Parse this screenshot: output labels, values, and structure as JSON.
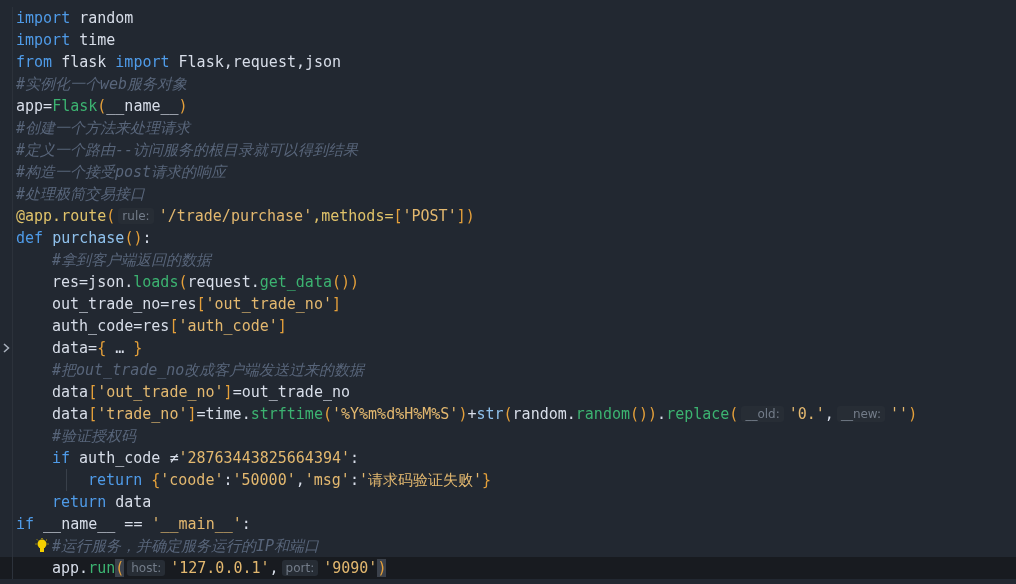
{
  "lines": [
    {
      "current": false,
      "tokens": [
        {
          "kind": "kw",
          "text": "import"
        },
        {
          "kind": "plain",
          "text": " random"
        }
      ]
    },
    {
      "current": false,
      "tokens": [
        {
          "kind": "kw",
          "text": "import"
        },
        {
          "kind": "plain",
          "text": " time"
        }
      ]
    },
    {
      "current": false,
      "tokens": [
        {
          "kind": "kw",
          "text": "from"
        },
        {
          "kind": "plain",
          "text": " flask "
        },
        {
          "kind": "kw",
          "text": "import"
        },
        {
          "kind": "plain",
          "text": " Flask,request,json"
        }
      ]
    },
    {
      "current": false,
      "tokens": [
        {
          "kind": "cm",
          "text": "#实例化一个web服务对象"
        }
      ]
    },
    {
      "current": false,
      "tokens": [
        {
          "kind": "plain",
          "text": "app="
        },
        {
          "kind": "fn",
          "text": "Flask"
        },
        {
          "kind": "br",
          "text": "("
        },
        {
          "kind": "plain",
          "text": "__name__"
        },
        {
          "kind": "br",
          "text": ")"
        }
      ]
    },
    {
      "current": false,
      "tokens": [
        {
          "kind": "cm",
          "text": "#创建一个方法来处理请求"
        }
      ]
    },
    {
      "current": false,
      "tokens": [
        {
          "kind": "cm",
          "text": "#定义一个路由--访问服务的根目录就可以得到结果"
        }
      ]
    },
    {
      "current": false,
      "tokens": [
        {
          "kind": "cm",
          "text": "#构造一个接受post请求的响应"
        }
      ]
    },
    {
      "current": false,
      "tokens": [
        {
          "kind": "cm",
          "text": "#处理极简交易接口"
        }
      ]
    },
    {
      "current": false,
      "tokens": [
        {
          "kind": "deco",
          "text": "@app.route"
        },
        {
          "kind": "br",
          "text": "("
        },
        {
          "kind": "hint",
          "text": "rule:"
        },
        {
          "kind": "str",
          "text": "'/trade/purchase'"
        },
        {
          "kind": "deco",
          "text": ",methods="
        },
        {
          "kind": "br",
          "text": "["
        },
        {
          "kind": "str",
          "text": "'POST'"
        },
        {
          "kind": "br",
          "text": "])"
        }
      ]
    },
    {
      "current": false,
      "tokens": [
        {
          "kind": "kw",
          "text": "def "
        },
        {
          "kind": "def",
          "text": "purchase"
        },
        {
          "kind": "br",
          "text": "()"
        },
        {
          "kind": "plain",
          "text": ":"
        }
      ],
      "children": [
        {
          "current": false,
          "tokens": [
            {
              "kind": "cm",
              "text": "#拿到客户端返回的数据"
            }
          ]
        },
        {
          "current": false,
          "tokens": [
            {
              "kind": "plain",
              "text": "res=json."
            },
            {
              "kind": "fn",
              "text": "loads"
            },
            {
              "kind": "br",
              "text": "("
            },
            {
              "kind": "plain",
              "text": "request."
            },
            {
              "kind": "fn",
              "text": "get_data"
            },
            {
              "kind": "br",
              "text": "())"
            }
          ]
        },
        {
          "current": false,
          "tokens": [
            {
              "kind": "plain",
              "text": "out_trade_no=res"
            },
            {
              "kind": "br",
              "text": "["
            },
            {
              "kind": "str",
              "text": "'out_trade_no'"
            },
            {
              "kind": "br",
              "text": "]"
            }
          ]
        },
        {
          "current": false,
          "tokens": [
            {
              "kind": "plain",
              "text": "auth_code=res"
            },
            {
              "kind": "br",
              "text": "["
            },
            {
              "kind": "str",
              "text": "'auth_code'"
            },
            {
              "kind": "br",
              "text": "]"
            }
          ]
        },
        {
          "current": false,
          "kind": "folded",
          "tokens": [
            {
              "kind": "plain",
              "text": "data="
            },
            {
              "kind": "br",
              "text": "{"
            },
            {
              "kind": "plain",
              "text": " … "
            },
            {
              "kind": "br",
              "text": "}"
            }
          ]
        },
        {
          "current": false,
          "tokens": [
            {
              "kind": "cm",
              "text": "#把out_trade_no改成客户端发送过来的数据"
            }
          ]
        },
        {
          "current": false,
          "tokens": [
            {
              "kind": "plain",
              "text": "data"
            },
            {
              "kind": "br",
              "text": "["
            },
            {
              "kind": "str",
              "text": "'out_trade_no'"
            },
            {
              "kind": "br",
              "text": "]"
            },
            {
              "kind": "plain",
              "text": "=out_trade_no"
            }
          ]
        },
        {
          "current": false,
          "tokens": [
            {
              "kind": "plain",
              "text": "data"
            },
            {
              "kind": "br",
              "text": "["
            },
            {
              "kind": "str",
              "text": "'trade_no'"
            },
            {
              "kind": "br",
              "text": "]"
            },
            {
              "kind": "plain",
              "text": "=time."
            },
            {
              "kind": "fn",
              "text": "strftime"
            },
            {
              "kind": "br",
              "text": "("
            },
            {
              "kind": "str",
              "text": "'%Y%m%d%H%M%S'"
            },
            {
              "kind": "br",
              "text": ")"
            },
            {
              "kind": "plain",
              "text": "+"
            },
            {
              "kind": "def",
              "text": "str"
            },
            {
              "kind": "br",
              "text": "("
            },
            {
              "kind": "plain",
              "text": "random."
            },
            {
              "kind": "fn",
              "text": "random"
            },
            {
              "kind": "br",
              "text": "())"
            },
            {
              "kind": "plain",
              "text": "."
            },
            {
              "kind": "fn",
              "text": "replace"
            },
            {
              "kind": "br",
              "text": "("
            },
            {
              "kind": "hint",
              "text": "__old:"
            },
            {
              "kind": "str",
              "text": "'0.'"
            },
            {
              "kind": "plain",
              "text": ","
            },
            {
              "kind": "hint",
              "text": "__new:"
            },
            {
              "kind": "str",
              "text": "''"
            },
            {
              "kind": "br",
              "text": ")"
            }
          ]
        },
        {
          "current": false,
          "tokens": [
            {
              "kind": "cm",
              "text": "#验证授权码"
            }
          ]
        },
        {
          "current": false,
          "tokens": [
            {
              "kind": "kw",
              "text": "if"
            },
            {
              "kind": "plain",
              "text": " auth_code ≠"
            },
            {
              "kind": "str",
              "text": "'28763443825664394'"
            },
            {
              "kind": "plain",
              "text": ":"
            }
          ],
          "children": [
            {
              "current": false,
              "tokens": [
                {
                  "kind": "kw",
                  "text": "return "
                },
                {
                  "kind": "br",
                  "text": "{"
                },
                {
                  "kind": "str",
                  "text": "'coode'"
                },
                {
                  "kind": "plain",
                  "text": ":"
                },
                {
                  "kind": "str",
                  "text": "'50000'"
                },
                {
                  "kind": "plain",
                  "text": ","
                },
                {
                  "kind": "str",
                  "text": "'msg'"
                },
                {
                  "kind": "plain",
                  "text": ":"
                },
                {
                  "kind": "str",
                  "text": "'请求码验证失败'"
                },
                {
                  "kind": "br",
                  "text": "}"
                }
              ]
            }
          ]
        },
        {
          "current": false,
          "tokens": [
            {
              "kind": "kw",
              "text": "return"
            },
            {
              "kind": "plain",
              "text": " data"
            }
          ]
        }
      ]
    },
    {
      "current": false,
      "tokens": [
        {
          "kind": "kw",
          "text": "if"
        },
        {
          "kind": "plain",
          "text": " __name__ == "
        },
        {
          "kind": "str",
          "text": "'__main__'"
        },
        {
          "kind": "plain",
          "text": ":"
        }
      ],
      "children": [
        {
          "current": false,
          "kind": "bulb",
          "tokens": [
            {
              "kind": "cm",
              "text": "#运行服务，并确定服务运行的IP和端口"
            }
          ]
        },
        {
          "current": true,
          "tokens": [
            {
              "kind": "plain",
              "text": "app."
            },
            {
              "kind": "fn",
              "text": "run"
            },
            {
              "kind": "match",
              "text": "("
            },
            {
              "kind": "hint",
              "text": "host:"
            },
            {
              "kind": "str",
              "text": "'127.0.0.1'"
            },
            {
              "kind": "plain",
              "text": ","
            },
            {
              "kind": "hint",
              "text": "port:"
            },
            {
              "kind": "str",
              "text": "'9090'"
            },
            {
              "kind": "match",
              "text": ")"
            }
          ]
        }
      ]
    }
  ]
}
